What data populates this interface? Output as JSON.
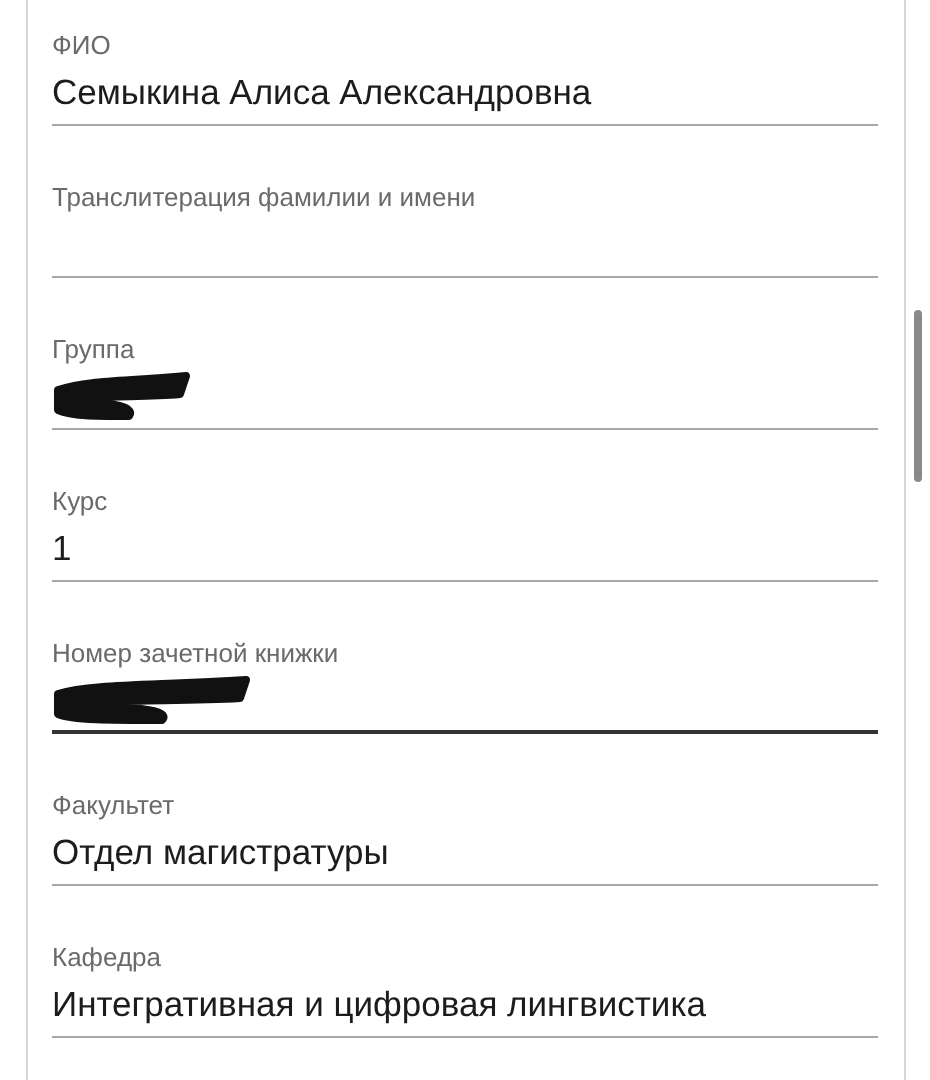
{
  "fields": [
    {
      "label": "ФИО",
      "value": "Семыкина Алиса Александровна",
      "redacted": false,
      "focused": false
    },
    {
      "label": "Транслитерация фамилии и имени",
      "redacted": false,
      "focused": false
    },
    {
      "label": "Группа",
      "redacted": true,
      "focused": false
    },
    {
      "label": "Курс",
      "value": "1",
      "redacted": false,
      "focused": false
    },
    {
      "label": "Номер зачетной книжки",
      "redacted": true,
      "focused": true
    },
    {
      "label": "Факультет",
      "value": "Отдел магистратуры",
      "redacted": false,
      "focused": false
    },
    {
      "label": "Кафедра",
      "value": "Интегративная и цифровая лингвистика",
      "redacted": false,
      "focused": false
    }
  ]
}
